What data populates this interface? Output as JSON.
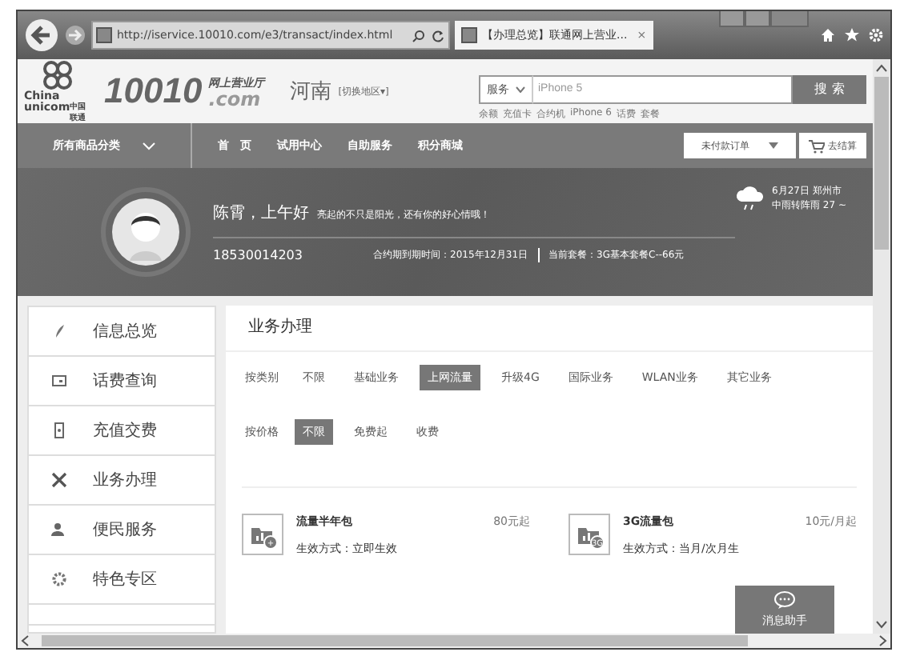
{
  "browser": {
    "url": "http://iservice.10010.com/e3/transact/index.html",
    "tab_title": "【办理总览】联通网上营业...",
    "tab_close": "×"
  },
  "header": {
    "logo_en_1": "China",
    "logo_en_2": "unicom",
    "logo_cn": "中国联通",
    "brand_number": "10010",
    "brand_sub": "网上营业厅",
    "brand_domain": ".com",
    "region": "河南",
    "region_switch": "[切换地区▾]",
    "search": {
      "category": "服务",
      "placeholder": "iPhone 5",
      "button": "搜 索"
    },
    "hot_words": [
      "余额",
      "充值卡",
      "合约机",
      "iPhone 6",
      "话费",
      "套餐"
    ]
  },
  "nav": {
    "category": "所有商品分类",
    "items": [
      "首　页",
      "试用中心",
      "自助服务",
      "积分商城"
    ],
    "order_select": "未付款订单",
    "cart": "去结算"
  },
  "banner": {
    "greeting": "陈霄，上午好",
    "motto": "亮起的不只是阳光，还有你的好心情哦！",
    "phone": "18530014203",
    "contract": "合约期到期时间：2015年12月31日",
    "plan": "当前套餐：3G基本套餐C--66元",
    "weather": {
      "date": "6月27日 郑州市",
      "forecast": "中雨转阵雨 27 ~"
    }
  },
  "sidebar": {
    "items": [
      {
        "label": "信息总览",
        "kind": "overview"
      },
      {
        "label": "话费查询",
        "kind": "bill"
      },
      {
        "label": "充值交费",
        "kind": "phone"
      },
      {
        "label": "业务办理",
        "kind": "tools"
      },
      {
        "label": "便民服务",
        "kind": "people"
      },
      {
        "label": "特色专区",
        "kind": "gear"
      }
    ]
  },
  "main": {
    "title": "业务办理",
    "filters": [
      {
        "label": "按类别",
        "options": [
          {
            "label": "不限",
            "selected": false
          },
          {
            "label": "基础业务",
            "selected": false
          },
          {
            "label": "上网流量",
            "selected": true
          },
          {
            "label": "升级4G",
            "selected": false
          },
          {
            "label": "国际业务",
            "selected": false
          },
          {
            "label": "WLAN业务",
            "selected": false
          },
          {
            "label": "其它业务",
            "selected": false
          }
        ]
      },
      {
        "label": "按价格",
        "options": [
          {
            "label": "不限",
            "selected": true
          },
          {
            "label": "免费起",
            "selected": false
          },
          {
            "label": "收费",
            "selected": false
          }
        ]
      }
    ],
    "products": [
      {
        "name": "流量半年包",
        "effect": "生效方式：立即生效",
        "price": "80元起",
        "badge": "+"
      },
      {
        "name": "3G流量包",
        "effect": "生效方式：当月/次月生",
        "price": "10元/月起",
        "badge": "3G"
      }
    ],
    "chat": "消息助手"
  }
}
